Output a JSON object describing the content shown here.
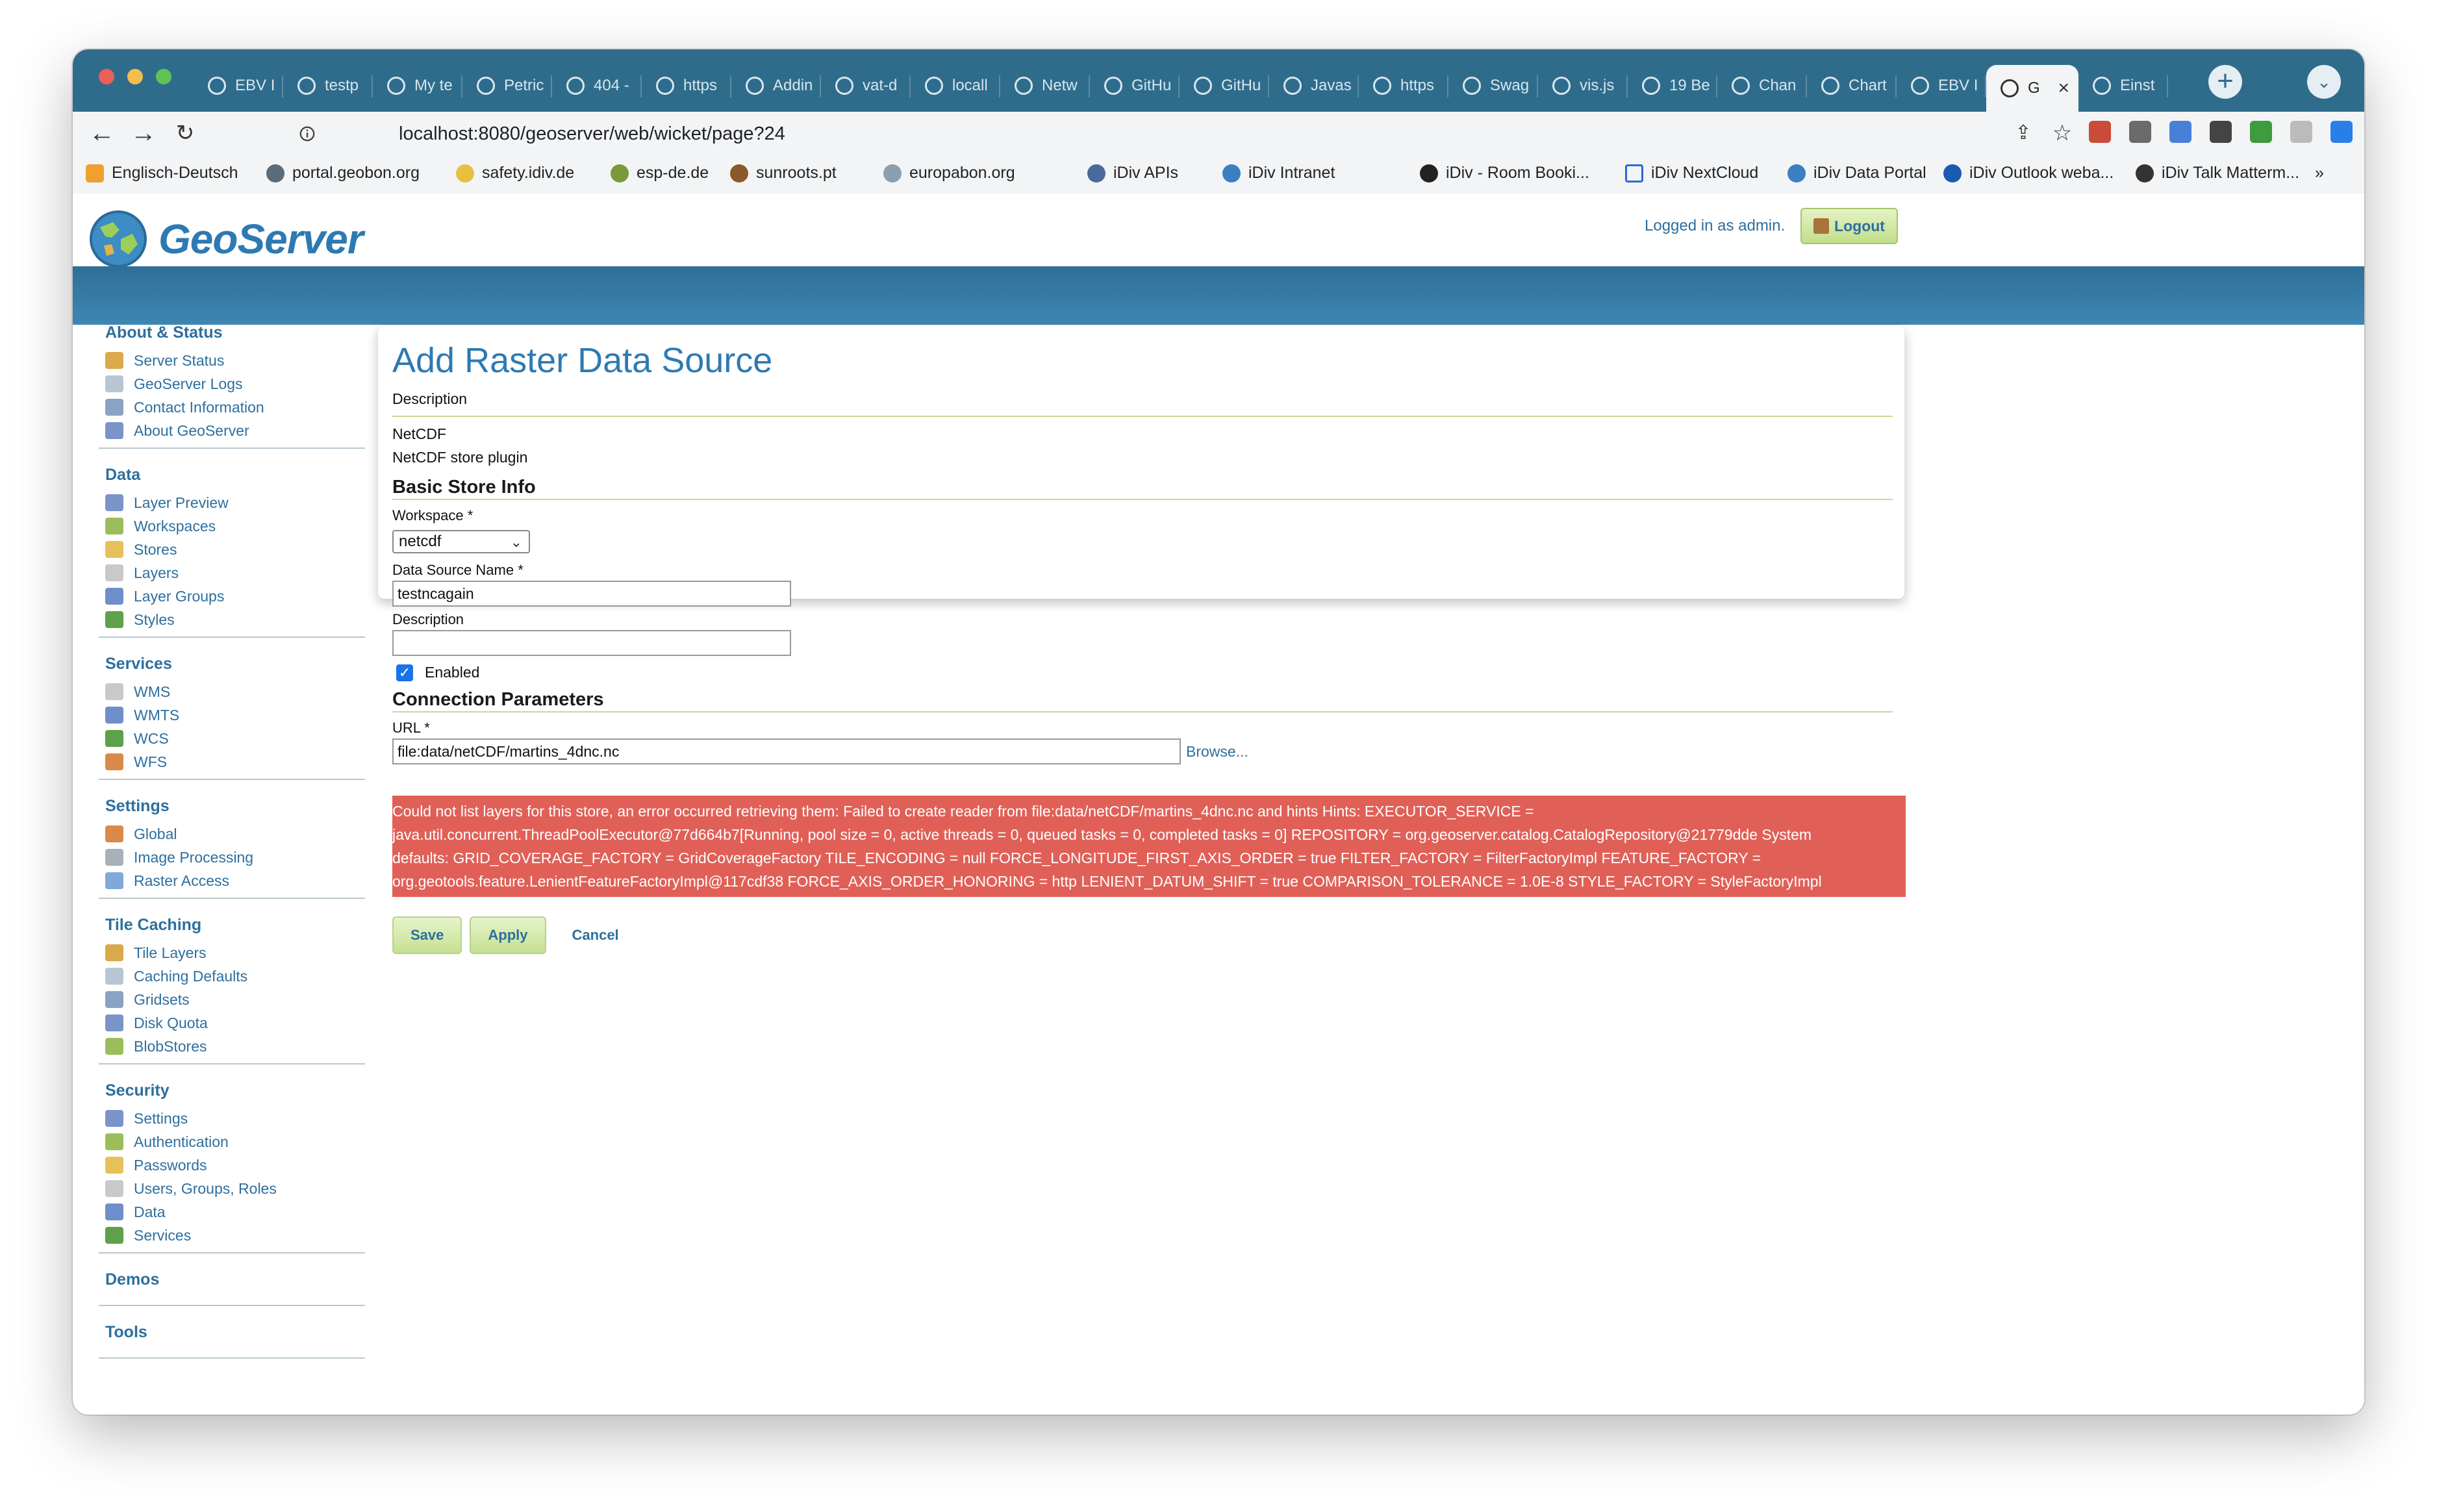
{
  "browser": {
    "tabs": [
      {
        "label": "EBV I"
      },
      {
        "label": "testp"
      },
      {
        "label": "My te"
      },
      {
        "label": "Petric"
      },
      {
        "label": "404 -"
      },
      {
        "label": "https"
      },
      {
        "label": "Addin"
      },
      {
        "label": "vat-d"
      },
      {
        "label": "locall"
      },
      {
        "label": "Netw"
      },
      {
        "label": "GitHu"
      },
      {
        "label": "GitHu"
      },
      {
        "label": "Javas"
      },
      {
        "label": "https"
      },
      {
        "label": "Swag"
      },
      {
        "label": "vis.js"
      },
      {
        "label": "19 Be"
      },
      {
        "label": "Chan"
      },
      {
        "label": "Chart"
      },
      {
        "label": "EBV I"
      },
      {
        "label": "G",
        "active": true
      },
      {
        "label": "Einst"
      }
    ],
    "url_host": "localhost",
    "url_path": ":8080/geoserver/web/wicket/page?24",
    "bookmarks": [
      {
        "label": "Englisch-Deutsch"
      },
      {
        "label": "portal.geobon.org"
      },
      {
        "label": "safety.idiv.de"
      },
      {
        "label": "esp-de.de"
      },
      {
        "label": "sunroots.pt"
      },
      {
        "label": "europabon.org"
      },
      {
        "label": "iDiv APIs"
      },
      {
        "label": "iDiv Intranet"
      },
      {
        "label": "iDiv - Room Booki..."
      },
      {
        "label": "iDiv NextCloud"
      },
      {
        "label": "iDiv Data Portal"
      },
      {
        "label": "iDiv Outlook weba..."
      },
      {
        "label": "iDiv Talk Matterm..."
      }
    ],
    "bookmarks_more": "»"
  },
  "header": {
    "logo_text": "GeoServer",
    "login_text": "Logged in as admin.",
    "logout_label": "Logout"
  },
  "sidebar": {
    "sections": [
      {
        "title": "About & Status",
        "items": [
          "Server Status",
          "GeoServer Logs",
          "Contact Information",
          "About GeoServer"
        ]
      },
      {
        "title": "Data",
        "items": [
          "Layer Preview",
          "Workspaces",
          "Stores",
          "Layers",
          "Layer Groups",
          "Styles"
        ]
      },
      {
        "title": "Services",
        "items": [
          "WMS",
          "WMTS",
          "WCS",
          "WFS"
        ]
      },
      {
        "title": "Settings",
        "items": [
          "Global",
          "Image Processing",
          "Raster Access"
        ]
      },
      {
        "title": "Tile Caching",
        "items": [
          "Tile Layers",
          "Caching Defaults",
          "Gridsets",
          "Disk Quota",
          "BlobStores"
        ]
      },
      {
        "title": "Security",
        "items": [
          "Settings",
          "Authentication",
          "Passwords",
          "Users, Groups, Roles",
          "Data",
          "Services"
        ]
      },
      {
        "title": "Demos",
        "items": []
      },
      {
        "title": "Tools",
        "items": []
      }
    ]
  },
  "form": {
    "title": "Add Raster Data Source",
    "description_label": "Description",
    "store_type": "NetCDF",
    "store_type_desc": "NetCDF store plugin",
    "basic_info_title": "Basic Store Info",
    "workspace_label": "Workspace *",
    "workspace_value": "netcdf",
    "name_label": "Data Source Name *",
    "name_value": "testncagain",
    "desc_label": "Description",
    "desc_value": "",
    "enabled_label": "Enabled",
    "connection_title": "Connection Parameters",
    "url_label": "URL *",
    "url_value": "file:data/netCDF/martins_4dnc.nc",
    "browse_label": "Browse...",
    "error_lines": [
      "Could not list layers for this store, an error occurred retrieving them: Failed to create reader from file:data/netCDF/martins_4dnc.nc and hints Hints: EXECUTOR_SERVICE =",
      "java.util.concurrent.ThreadPoolExecutor@77d664b7[Running, pool size = 0, active threads = 0, queued tasks = 0, completed tasks = 0] REPOSITORY = org.geoserver.catalog.CatalogRepository@21779dde System",
      "defaults: GRID_COVERAGE_FACTORY = GridCoverageFactory TILE_ENCODING = null FORCE_LONGITUDE_FIRST_AXIS_ORDER = true FILTER_FACTORY = FilterFactoryImpl FEATURE_FACTORY =",
      "org.geotools.feature.LenientFeatureFactoryImpl@117cdf38 FORCE_AXIS_ORDER_HONORING = http LENIENT_DATUM_SHIFT = true COMPARISON_TOLERANCE = 1.0E-8 STYLE_FACTORY = StyleFactoryImpl"
    ],
    "save_label": "Save",
    "apply_label": "Apply",
    "cancel_label": "Cancel"
  },
  "colors": {
    "tab_bar": "#2f6c8c",
    "geoserver_blue": "#2d7ab3",
    "error_bg": "#e06057",
    "button_green": "#c4e091"
  }
}
